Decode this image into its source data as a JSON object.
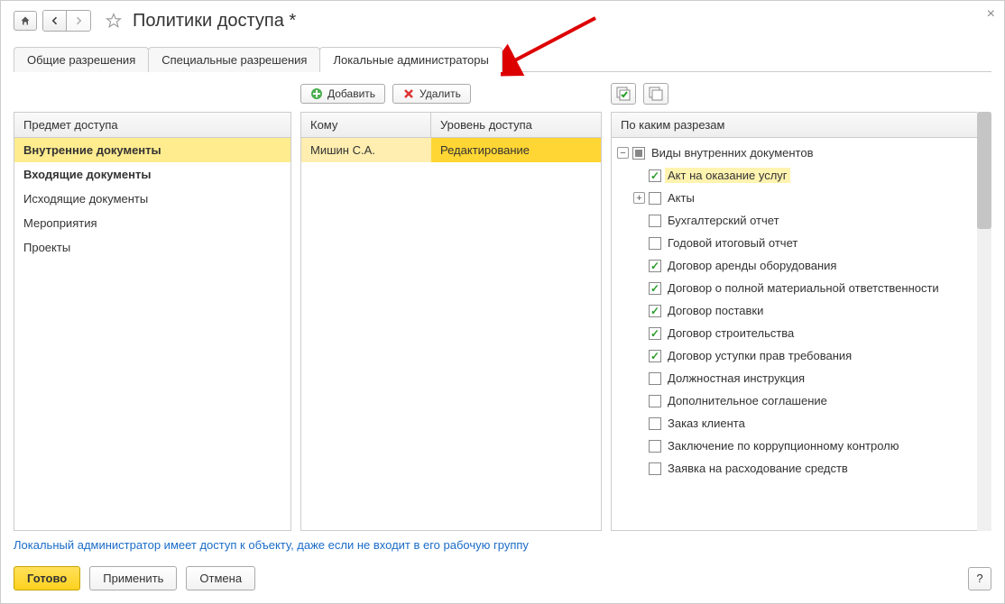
{
  "title": "Политики доступа *",
  "tabs": {
    "t0": "Общие разрешения",
    "t1": "Специальные разрешения",
    "t2": "Локальные администраторы"
  },
  "toolbar": {
    "add": "Добавить",
    "delete": "Удалить"
  },
  "col1": {
    "header": "Предмет доступа",
    "items": [
      "Внутренние документы",
      "Входящие документы",
      "Исходящие документы",
      "Мероприятия",
      "Проекты"
    ]
  },
  "col2": {
    "hA": "Кому",
    "hB": "Уровень доступа",
    "rows": [
      {
        "a": "Мишин С.А.",
        "b": "Редактирование"
      }
    ]
  },
  "col3": {
    "header": "По каким разрезам",
    "nodes": [
      {
        "level": 0,
        "toggle": "⊖",
        "cb": "mixed",
        "label": "Виды внутренних документов"
      },
      {
        "level": 1,
        "toggle": "",
        "cb": "checked",
        "label": "Акт на оказание услуг",
        "selected": true
      },
      {
        "level": 1,
        "toggle": "⊕",
        "cb": "",
        "label": "Акты"
      },
      {
        "level": 1,
        "toggle": "",
        "cb": "",
        "label": "Бухгалтерский отчет"
      },
      {
        "level": 1,
        "toggle": "",
        "cb": "",
        "label": "Годовой итоговый отчет"
      },
      {
        "level": 1,
        "toggle": "",
        "cb": "checked",
        "label": "Договор аренды оборудования"
      },
      {
        "level": 1,
        "toggle": "",
        "cb": "checked",
        "label": "Договор о полной материальной ответственности"
      },
      {
        "level": 1,
        "toggle": "",
        "cb": "checked",
        "label": "Договор поставки"
      },
      {
        "level": 1,
        "toggle": "",
        "cb": "checked",
        "label": "Договор строительства"
      },
      {
        "level": 1,
        "toggle": "",
        "cb": "checked",
        "label": "Договор уступки прав требования"
      },
      {
        "level": 1,
        "toggle": "",
        "cb": "",
        "label": "Должностная инструкция"
      },
      {
        "level": 1,
        "toggle": "",
        "cb": "",
        "label": "Дополнительное соглашение"
      },
      {
        "level": 1,
        "toggle": "",
        "cb": "",
        "label": "Заказ клиента"
      },
      {
        "level": 1,
        "toggle": "",
        "cb": "",
        "label": "Заключение по коррупционному контролю"
      },
      {
        "level": 1,
        "toggle": "",
        "cb": "",
        "label": "Заявка на расходование средств"
      }
    ]
  },
  "hint": "Локальный администратор имеет доступ к объекту, даже если не входит в его рабочую группу",
  "footer": {
    "ok": "Готово",
    "apply": "Применить",
    "cancel": "Отмена",
    "help": "?"
  }
}
